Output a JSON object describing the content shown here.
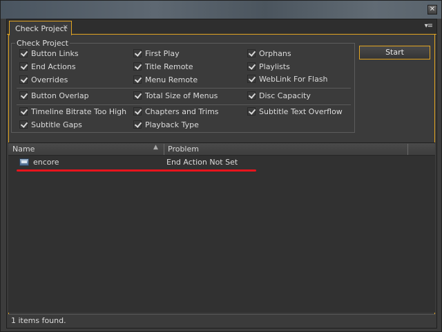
{
  "window": {
    "close_glyph": "✕"
  },
  "tab": {
    "title": "Check Project",
    "close_glyph": "×"
  },
  "panel_menu_glyph": "▾≡",
  "group": {
    "title": "Check Project",
    "items": [
      {
        "label": "Button Links",
        "checked": true
      },
      {
        "label": "First Play",
        "checked": true
      },
      {
        "label": "Orphans",
        "checked": true
      },
      {
        "label": "End Actions",
        "checked": true
      },
      {
        "label": "Title Remote",
        "checked": true
      },
      {
        "label": "Playlists",
        "checked": true
      },
      {
        "label": "Overrides",
        "checked": true
      },
      {
        "label": "Menu Remote",
        "checked": true
      },
      {
        "label": "WebLink For Flash",
        "checked": true
      },
      {
        "label": "Button Overlap",
        "checked": true
      },
      {
        "label": "Total Size of Menus",
        "checked": true
      },
      {
        "label": "Disc Capacity",
        "checked": true
      },
      {
        "label": "Timeline Bitrate Too High",
        "checked": true
      },
      {
        "label": "Chapters and Trims",
        "checked": true
      },
      {
        "label": "Subtitle Text Overflow",
        "checked": true
      },
      {
        "label": "Subtitle Gaps",
        "checked": true
      },
      {
        "label": "Playback Type",
        "checked": true
      }
    ]
  },
  "start_label": "Start",
  "list": {
    "columns": {
      "name": "Name",
      "problem": "Problem",
      "sort_glyph": "▲"
    },
    "rows": [
      {
        "icon": "project-icon",
        "name": "encore",
        "problem": "End Action Not Set"
      }
    ]
  },
  "status_text": "1 items found.",
  "colors": {
    "accent": "#e3a521",
    "highlight_line": "#e8141c"
  }
}
